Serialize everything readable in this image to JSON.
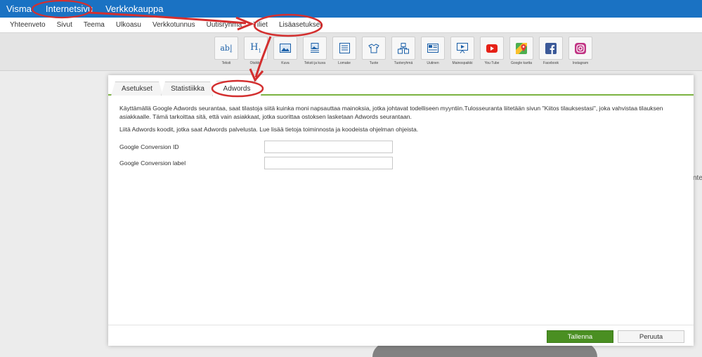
{
  "topbar": {
    "brand": "Visma",
    "internetsivu": "Internetsivu",
    "verkkokauppa": "Verkkokauppa"
  },
  "subnav": {
    "items": [
      "Yhteenveto",
      "Sivut",
      "Teema",
      "Ulkoasu",
      "Verkkotunnus",
      "Uutisryhmä",
      "Tiliet",
      "Lisäasetukset"
    ]
  },
  "toolbar": {
    "items": [
      {
        "label": "Teksti",
        "icon": "text-icon"
      },
      {
        "label": "Otsikko",
        "icon": "heading-icon"
      },
      {
        "label": "Kuva",
        "icon": "image-icon"
      },
      {
        "label": "Teksti ja kuva",
        "icon": "text-image-icon"
      },
      {
        "label": "Lomake",
        "icon": "form-icon"
      },
      {
        "label": "Tuote",
        "icon": "product-icon"
      },
      {
        "label": "Tuoteryhmä",
        "icon": "product-group-icon"
      },
      {
        "label": "Uutinen",
        "icon": "news-icon"
      },
      {
        "label": "Mainospaikki",
        "icon": "ad-slot-icon"
      },
      {
        "label": "You Tube",
        "icon": "youtube-icon"
      },
      {
        "label": "Google kartta",
        "icon": "google-maps-icon"
      },
      {
        "label": "Facebook",
        "icon": "facebook-icon"
      },
      {
        "label": "Instagram",
        "icon": "instagram-icon"
      }
    ]
  },
  "background": {
    "edge_text": "nte"
  },
  "modal": {
    "tabs": [
      "Asetukset",
      "Statistiikka",
      "Adwords"
    ],
    "active_tab": "Adwords",
    "description": "Käyttämällä Google Adwords seurantaa, saat tilastoja siitä kuinka moni napsauttaa mainoksia, jotka johtavat todelliseen myyntiin.Tulosseuranta liitetään sivun \"Kiitos tilauksestasi\", joka vahvistaa tilauksen asiakkaalle. Tämä tarkoittaa sitä, että vain asiakkaat, jotka suorittaa ostoksen lasketaan Adwords seurantaan.",
    "instruction": "Liitä Adwords koodit, jotka saat Adwords palvelusta. Lue lisää tietoja toiminnosta ja koodeista ohjelman ohjeista.",
    "fields": [
      {
        "label": "Google Conversion ID",
        "value": "",
        "placeholder": ""
      },
      {
        "label": "Google Conversion label",
        "value": "",
        "placeholder": ""
      }
    ],
    "save_label": "Tallenna",
    "cancel_label": "Peruuta"
  },
  "colors": {
    "topbar": "#1a72c3",
    "tab_underline": "#7cb342",
    "save_button": "#4a8f22",
    "annotation": "#d32f2f"
  }
}
